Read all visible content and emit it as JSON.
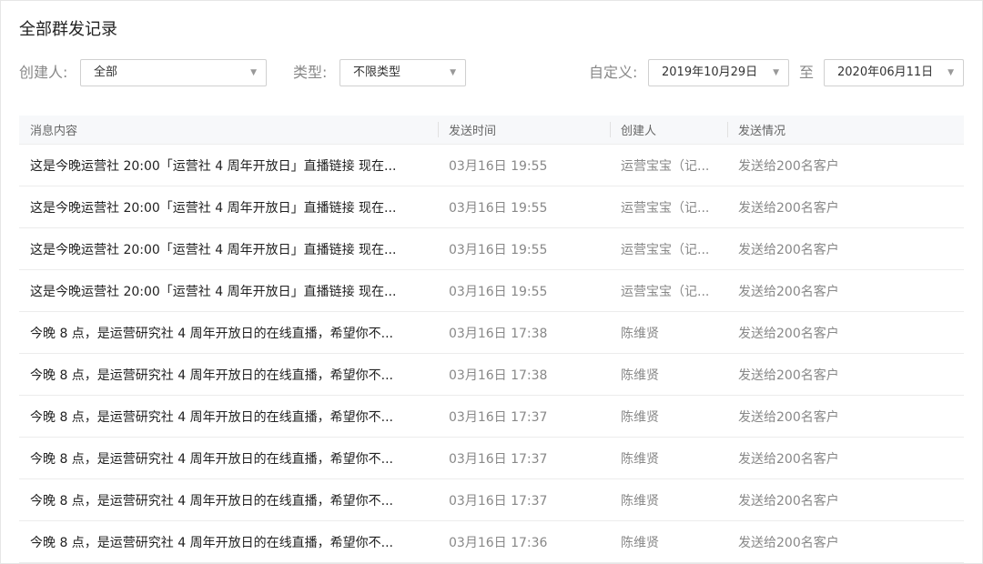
{
  "header": {
    "title": "全部群发记录"
  },
  "filters": {
    "creator_label": "创建人:",
    "creator_value": "全部",
    "type_label": "类型:",
    "type_value": "不限类型",
    "custom_label": "自定义:",
    "date_from": "2019年10月29日",
    "to_label": "至",
    "date_to": "2020年06月11日"
  },
  "table": {
    "columns": [
      "消息内容",
      "发送时间",
      "创建人",
      "发送情况"
    ],
    "rows": [
      [
        "这是今晚运营社 20:00「运营社 4 周年开放日」直播链接 现在...",
        "03月16日 19:55",
        "运营宝宝（记...",
        "发送给200名客户"
      ],
      [
        "这是今晚运营社 20:00「运营社 4 周年开放日」直播链接 现在...",
        "03月16日 19:55",
        "运营宝宝（记...",
        "发送给200名客户"
      ],
      [
        "这是今晚运营社 20:00「运营社 4 周年开放日」直播链接 现在...",
        "03月16日 19:55",
        "运营宝宝（记...",
        "发送给200名客户"
      ],
      [
        "这是今晚运营社 20:00「运营社 4 周年开放日」直播链接 现在...",
        "03月16日 19:55",
        "运营宝宝（记...",
        "发送给200名客户"
      ],
      [
        "今晚 8 点，是运营研究社 4 周年开放日的在线直播，希望你不...",
        "03月16日 17:38",
        "陈维贤",
        "发送给200名客户"
      ],
      [
        "今晚 8 点，是运营研究社 4 周年开放日的在线直播，希望你不...",
        "03月16日 17:38",
        "陈维贤",
        "发送给200名客户"
      ],
      [
        "今晚 8 点，是运营研究社 4 周年开放日的在线直播，希望你不...",
        "03月16日 17:37",
        "陈维贤",
        "发送给200名客户"
      ],
      [
        "今晚 8 点，是运营研究社 4 周年开放日的在线直播，希望你不...",
        "03月16日 17:37",
        "陈维贤",
        "发送给200名客户"
      ],
      [
        "今晚 8 点，是运营研究社 4 周年开放日的在线直播，希望你不...",
        "03月16日 17:37",
        "陈维贤",
        "发送给200名客户"
      ],
      [
        "今晚 8 点，是运营研究社 4 周年开放日的在线直播，希望你不...",
        "03月16日 17:36",
        "陈维贤",
        "发送给200名客户"
      ]
    ]
  }
}
